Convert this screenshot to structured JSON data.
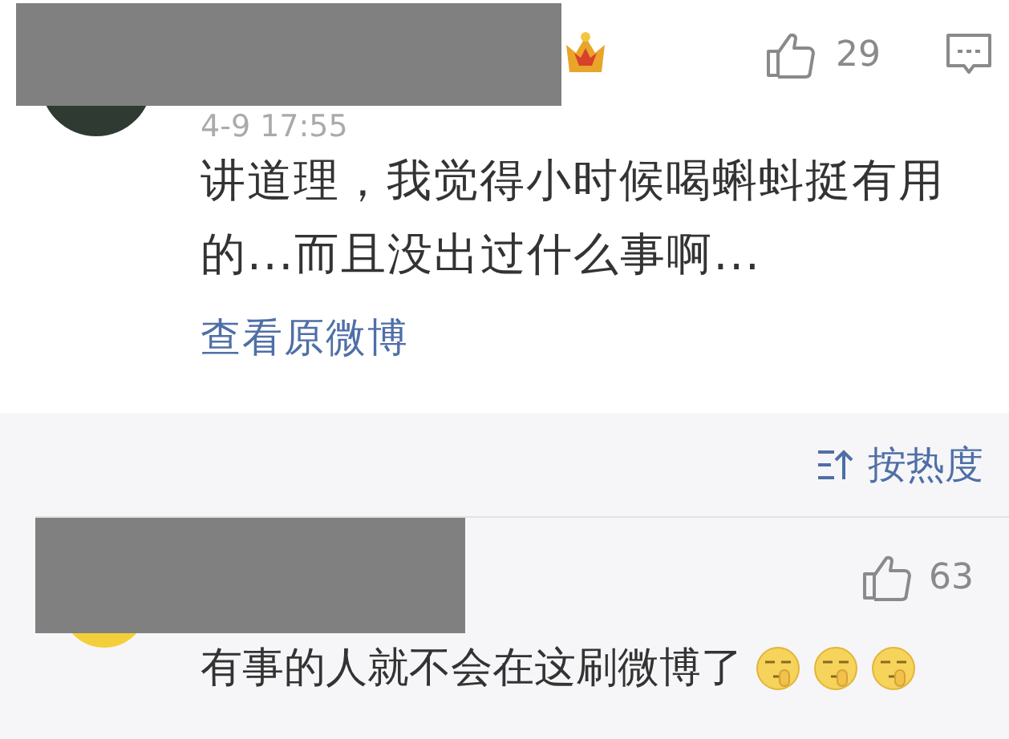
{
  "top_comment": {
    "vip_badge": true,
    "likes": "29",
    "reply_button": true,
    "time": "4-9 17:55",
    "text": "讲道理，我觉得小时候喝蝌蚪挺有用的...而且没出过什么事啊...",
    "link": "查看原微博"
  },
  "sort": {
    "label": "按热度"
  },
  "replies": [
    {
      "likes": "63",
      "text": "有事的人就不会在这刷微博了",
      "emojis": [
        {
          "kind": "shush"
        },
        {
          "kind": "shush"
        },
        {
          "kind": "shush"
        }
      ]
    }
  ]
}
